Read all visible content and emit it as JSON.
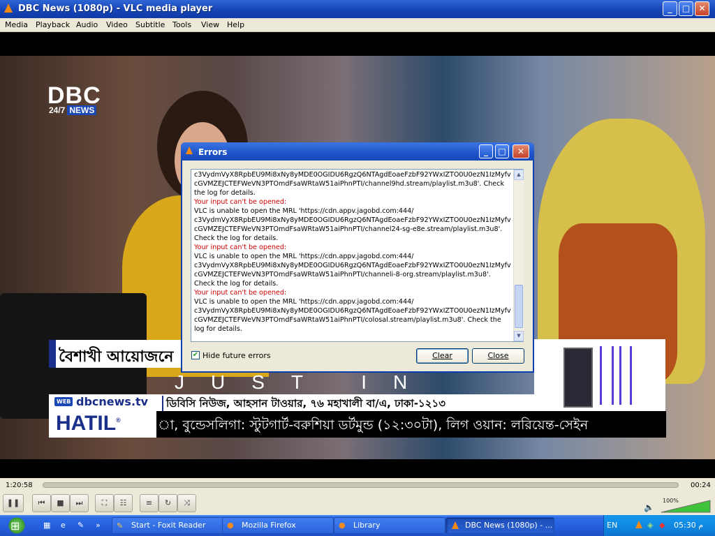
{
  "window": {
    "title": "DBC News (1080p) - VLC media player",
    "minimize": "_",
    "maximize": "□",
    "close": "✕"
  },
  "menu": [
    "Media",
    "Playback",
    "Audio",
    "Video",
    "Subtitle",
    "Tools",
    "View",
    "Help"
  ],
  "video": {
    "logo_text": "DBC",
    "logo_sub": "24/7",
    "logo_news": "NEWS",
    "headline": "বৈশাখী আয়োজনে",
    "just_in": "JUST IN",
    "web_badge": "WEB",
    "web_url": "dbcnews.tv",
    "web_address": "ডিবিসি নিউজ, আহসান টাওয়ার, ৭৬ মহাখালী বা/এ, ঢাকা-১২১৩",
    "sponsor": "HATIL",
    "sponsor_mark": "®",
    "ticker": "া, বুন্ডেসলিগা: স্টুটগার্ট-বরুশিয়া ডর্টমুন্ড (১২:৩০টা), লিগ ওয়ান: লরিয়েন্ত-সেইন"
  },
  "dialog": {
    "title": "Errors",
    "lines": [
      {
        "type": "text",
        "text": "c3VydmVyX8RpbEU9Mi8xNy8yMDE0OGIDU6RgzQ6NTAgdEoaeFzbF92YWxIZTO0U0ezN1IzMyfv"
      },
      {
        "type": "text",
        "text": "cGVMZEJCTEFWeVN3PTOmdFsaWRtaW51aiPhnPTI/channel9hd.stream/playlist.m3u8'. Check"
      },
      {
        "type": "text",
        "text": "the log for details."
      },
      {
        "type": "err",
        "text": "Your input can't be opened:"
      },
      {
        "type": "text",
        "text": "VLC is unable to open the MRL 'https://cdn.appv.jagobd.com:444/"
      },
      {
        "type": "text",
        "text": "c3VydmVyX8RpbEU9Mi8xNy8yMDE0OGIDU6RgzQ6NTAgdEoaeFzbF92YWxIZTO0U0ezN1IzMyfv"
      },
      {
        "type": "text",
        "text": "cGVMZEJCTEFWeVN3PTOmdFsaWRtaW51aiPhnPTI/channel24-sg-e8e.stream/playlist.m3u8'."
      },
      {
        "type": "text",
        "text": "Check the log for details."
      },
      {
        "type": "err",
        "text": "Your input can't be opened:"
      },
      {
        "type": "text",
        "text": "VLC is unable to open the MRL 'https://cdn.appv.jagobd.com:444/"
      },
      {
        "type": "text",
        "text": "c3VydmVyX8RpbEU9Mi8xNy8yMDE0OGIDU6RgzQ6NTAgdEoaeFzbF92YWxIZTO0U0ezN1IzMyfv"
      },
      {
        "type": "text",
        "text": "cGVMZEJCTEFWeVN3PTOmdFsaWRtaW51aiPhnPTI/channeli-8-org.stream/playlist.m3u8'."
      },
      {
        "type": "text",
        "text": "Check the log for details."
      },
      {
        "type": "err",
        "text": "Your input can't be opened:"
      },
      {
        "type": "text",
        "text": "VLC is unable to open the MRL 'https://cdn.appv.jagobd.com:444/"
      },
      {
        "type": "text",
        "text": "c3VydmVyX8RpbEU9Mi8xNy8yMDE0OGIDU6RgzQ6NTAgdEoaeFzbF92YWxIZTO0U0ezN1IzMyfv"
      },
      {
        "type": "text",
        "text": "cGVMZEJCTEFWeVN3PTOmdFsaWRtaW51aiPhnPTI/colosal.stream/playlist.m3u8'. Check the"
      },
      {
        "type": "text",
        "text": "log for details."
      }
    ],
    "hide_errors_label": "Hide future errors",
    "hide_errors_checked": true,
    "clear_label": "Clear",
    "close_label": "Close"
  },
  "player": {
    "elapsed": "1:20:58",
    "remaining": "00:24",
    "volume": "100%"
  },
  "taskbar": {
    "items": [
      {
        "label": "Start - Foxit Reader",
        "icon": "foxit-icon"
      },
      {
        "label": "Mozilla Firefox",
        "icon": "firefox-icon"
      },
      {
        "label": "Library",
        "icon": "firefox-icon"
      },
      {
        "label": "DBC News (1080p) - ...",
        "icon": "vlc-icon"
      }
    ],
    "language": "EN",
    "clock": "05:30 م"
  }
}
